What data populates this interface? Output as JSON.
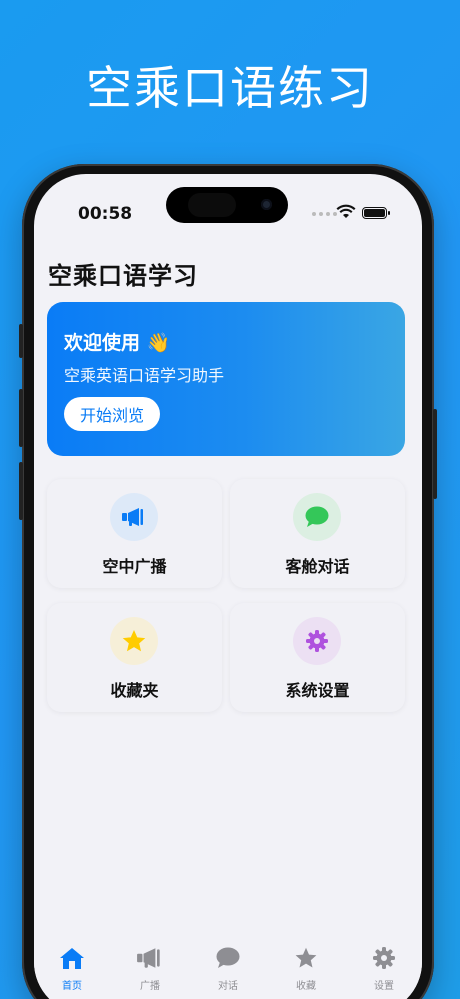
{
  "headline": "空乘口语练习",
  "status": {
    "time": "00:58"
  },
  "page_title": "空乘口语学习",
  "welcome": {
    "title": "欢迎使用 👋",
    "subtitle": "空乘英语口语学习助手",
    "button": "开始浏览"
  },
  "cards": [
    {
      "label": "空中广播",
      "icon": "megaphone-icon",
      "color": "#0a7cf6",
      "bg": "#dde9f8"
    },
    {
      "label": "客舱对话",
      "icon": "chat-bubble-icon",
      "color": "#34c759",
      "bg": "#dcefe2"
    },
    {
      "label": "收藏夹",
      "icon": "star-icon",
      "color": "#ffcc00",
      "bg": "#f6efd8"
    },
    {
      "label": "系统设置",
      "icon": "gear-icon",
      "color": "#af52de",
      "bg": "#ece0f3"
    }
  ],
  "tabs": [
    {
      "label": "首页",
      "icon": "home-icon",
      "active": true
    },
    {
      "label": "广播",
      "icon": "megaphone-icon",
      "active": false
    },
    {
      "label": "对话",
      "icon": "chat-bubble-icon",
      "active": false
    },
    {
      "label": "收藏",
      "icon": "star-icon",
      "active": false
    },
    {
      "label": "设置",
      "icon": "gear-icon",
      "active": false
    }
  ],
  "colors": {
    "accent": "#0a7cf6",
    "inactive": "#8e8e93",
    "background": "#f2f2f7"
  }
}
